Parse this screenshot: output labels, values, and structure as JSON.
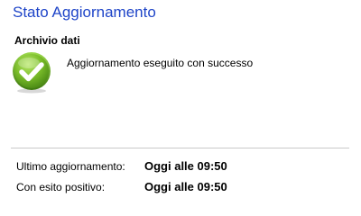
{
  "header": {
    "title": "Stato Aggiornamento"
  },
  "archive": {
    "section_title": "Archivio dati",
    "status_icon": "success-check-icon",
    "status_message": "Aggiornamento eseguito con successo",
    "accent_color": "#7bbd2a"
  },
  "details": {
    "rows": [
      {
        "label": "Ultimo aggiornamento:",
        "value": "Oggi alle 09:50"
      },
      {
        "label": "Con esito positivo:",
        "value": "Oggi alle 09:50"
      }
    ]
  },
  "colors": {
    "title": "#1f45c8",
    "divider": "#c8c8c8"
  }
}
